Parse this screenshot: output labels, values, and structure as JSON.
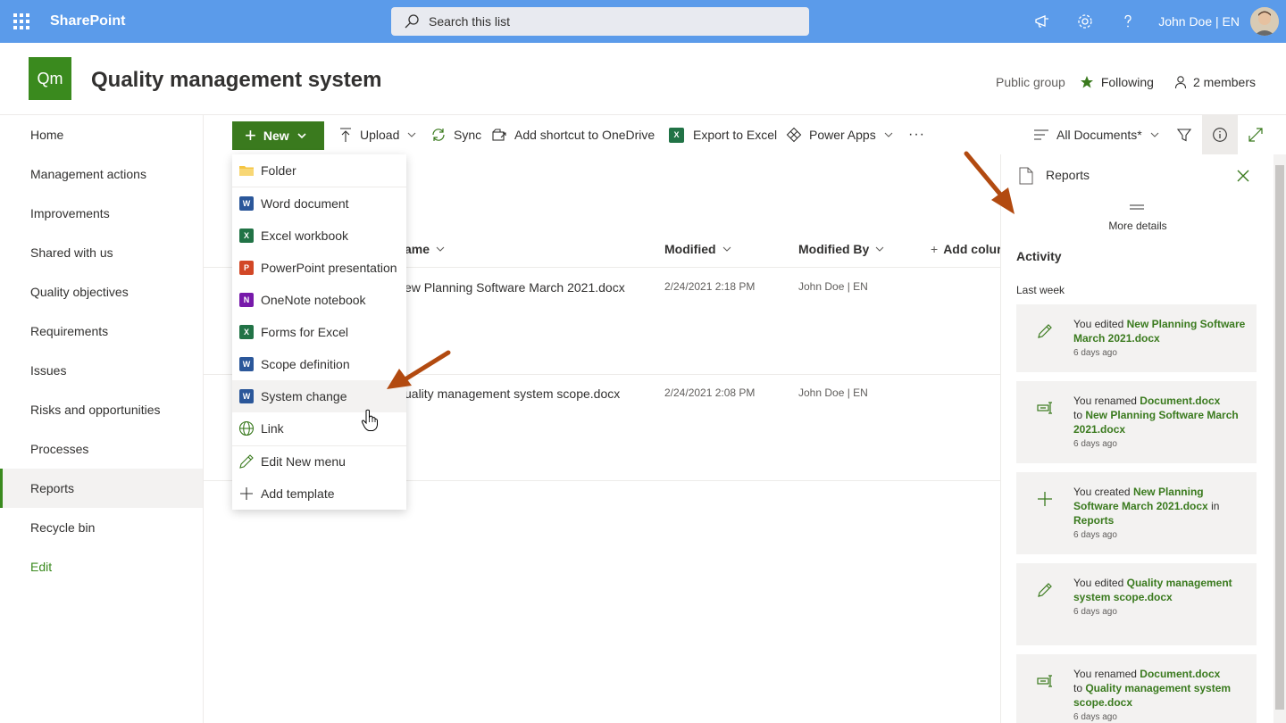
{
  "suitebar": {
    "brand": "SharePoint",
    "search_placeholder": "Search this list",
    "user": "John Doe | EN"
  },
  "site": {
    "logo": "Qm",
    "title": "Quality management system",
    "group": "Public group",
    "following": "Following",
    "members": "2 members"
  },
  "nav": {
    "items": [
      "Home",
      "Management actions",
      "Improvements",
      "Shared with us",
      "Quality objectives",
      "Requirements",
      "Issues",
      "Risks and opportunities",
      "Processes",
      "Reports",
      "Recycle bin"
    ],
    "active": "Reports",
    "edit": "Edit"
  },
  "commandbar": {
    "new": "New",
    "upload": "Upload",
    "sync": "Sync",
    "shortcut": "Add shortcut to OneDrive",
    "export": "Export to Excel",
    "powerapps": "Power Apps",
    "more": "···",
    "view": "All Documents*"
  },
  "list": {
    "columns": {
      "name": "ame",
      "modified": "Modified",
      "modified_by": "Modified By",
      "add_column": "Add colur"
    },
    "rows": [
      {
        "name": "ew Planning Software March 2021.docx",
        "modified": "2/24/2021 2:18 PM",
        "modified_by": "John Doe | EN"
      },
      {
        "name": "uality management system scope.docx",
        "modified": "2/24/2021 2:08 PM",
        "modified_by": "John Doe | EN"
      }
    ]
  },
  "new_menu": {
    "items": [
      "Folder",
      "Word document",
      "Excel workbook",
      "PowerPoint presentation",
      "OneNote notebook",
      "Forms for Excel",
      "Scope definition",
      "System change",
      "Link",
      "Edit New menu",
      "Add template"
    ],
    "icon_letters": {
      "word": "W",
      "excel": "X",
      "powerpoint": "P",
      "onenote": "N"
    }
  },
  "details_pane": {
    "title": "Reports",
    "more_details": "More details",
    "activity_heading": "Activity",
    "period": "Last week",
    "activities": [
      {
        "icon": "pencil-icon",
        "parts": [
          "You edited ",
          "New Planning Software March 2021.docx"
        ],
        "time": "6 days ago"
      },
      {
        "icon": "rename-icon",
        "parts": [
          "You renamed ",
          "Document.docx",
          " to ",
          "New Planning Software March 2021.docx"
        ],
        "time": "6 days ago"
      },
      {
        "icon": "plus-icon",
        "parts": [
          "You created ",
          "New Planning Software March 2021.docx",
          " in ",
          "Reports"
        ],
        "time": "6 days ago"
      },
      {
        "icon": "pencil-icon",
        "parts": [
          "You edited ",
          "Quality management system scope.docx"
        ],
        "time": "6 days ago"
      },
      {
        "icon": "rename-icon",
        "parts": [
          "You renamed ",
          "Document.docx",
          " to ",
          "Quality management system scope.docx"
        ],
        "time": "6 days ago"
      }
    ]
  },
  "colors": {
    "suitebar": "#5b9bea",
    "accent": "#3a7a1e",
    "arrow": "#b24a10",
    "word": "#2b579a",
    "excel": "#217346",
    "powerpoint": "#d24726",
    "onenote": "#7719aa"
  }
}
